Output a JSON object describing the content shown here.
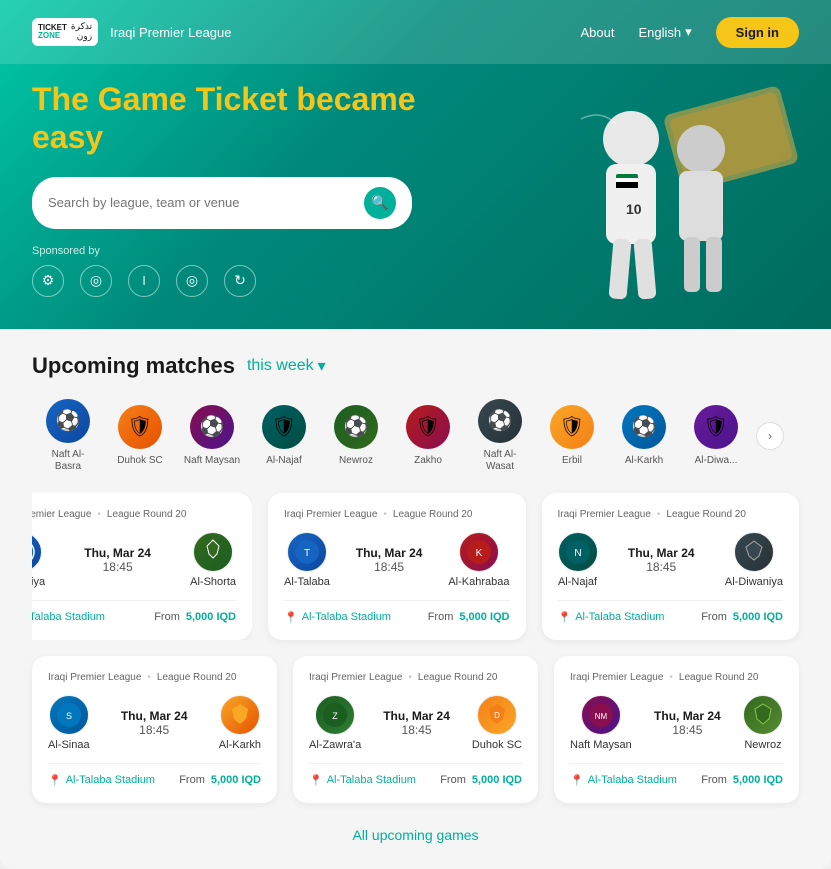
{
  "header": {
    "logo_ticket": "TICKET",
    "logo_zone": "ZONE",
    "logo_arabic": "تذكرة\nزون",
    "league_name": "Iraqi Premier League",
    "nav_about": "About",
    "nav_lang": "English",
    "nav_signin": "Sign in"
  },
  "hero": {
    "title_main": "The Game Ticket became ",
    "title_highlight": "easy",
    "search_placeholder": "Search by league, team or venue",
    "sponsored_label": "Sponsored by",
    "sponsors": [
      "⚙",
      "◎",
      "ﺍ",
      "◎",
      "↻"
    ]
  },
  "upcoming": {
    "title": "Upcoming matches",
    "filter": "this week",
    "teams": [
      {
        "name": "Naft Al-Basra",
        "emoji": "🛡"
      },
      {
        "name": "Duhok SC",
        "emoji": "🛡"
      },
      {
        "name": "Naft Maysan",
        "emoji": "🛡"
      },
      {
        "name": "Al-Najaf",
        "emoji": "🛡"
      },
      {
        "name": "Newroz",
        "emoji": "🛡"
      },
      {
        "name": "Zakho",
        "emoji": "🛡"
      },
      {
        "name": "Naft Al-Wasat",
        "emoji": "🛡"
      },
      {
        "name": "Erbil",
        "emoji": "🛡"
      },
      {
        "name": "Al-Karkh",
        "emoji": "🛡"
      },
      {
        "name": "Al-Diwa...",
        "emoji": "🛡"
      }
    ]
  },
  "partial_card": {
    "league": "Iraqi Premier League",
    "round": "League Round 20",
    "date": "Thu, Mar 24",
    "time": "18:45",
    "team1_name": "Al-Jawiya",
    "team2_name": "Al-Shorta",
    "team1_emoji": "🔵",
    "team2_emoji": "🛡",
    "venue": "Al-Talaba Stadium",
    "from_label": "From",
    "price": "5,000 IQD"
  },
  "cards": [
    {
      "league": "Iraqi Premier League",
      "round": "League Round 20",
      "date": "Thu, Mar 24",
      "time": "18:45",
      "team1_name": "Al-Talaba",
      "team2_name": "Al-Kahrabaa",
      "team1_emoji": "🔵",
      "team2_emoji": "🔴",
      "venue": "Al-Talaba Stadium",
      "from_label": "From",
      "price": "5,000 IQD"
    },
    {
      "league": "Iraqi Premier League",
      "round": "League Round 20",
      "date": "Thu, Mar 24",
      "time": "18:45",
      "team1_name": "Al-Najaf",
      "team2_name": "Al-Diwaniya",
      "team1_emoji": "🛡",
      "team2_emoji": "🛡",
      "venue": "Al-Talaba Stadium",
      "from_label": "From",
      "price": "5,000 IQD"
    }
  ],
  "bottom_cards": [
    {
      "league": "Iraqi Premier League",
      "round": "League Round 20",
      "date": "Thu, Mar 24",
      "time": "18:45",
      "team1_name": "Al-Sinaa",
      "team2_name": "Al-Karkh",
      "team1_emoji": "🛡",
      "team2_emoji": "🛡",
      "venue": "Al-Talaba Stadium",
      "from_label": "From",
      "price": "5,000 IQD"
    },
    {
      "league": "Iraqi Premier League",
      "round": "League Round 20",
      "date": "Thu, Mar 24",
      "time": "18:45",
      "team1_name": "Al-Zawra'a",
      "team2_name": "Duhok SC",
      "team1_emoji": "🟢",
      "team2_emoji": "🟡",
      "venue": "Al-Talaba Stadium",
      "from_label": "From",
      "price": "5,000 IQD"
    },
    {
      "league": "Iraqi Premier League",
      "round": "League Round 20",
      "date": "Thu, Mar 24",
      "time": "18:45",
      "team1_name": "Naft Maysan",
      "team2_name": "Newroz",
      "team1_emoji": "🛡",
      "team2_emoji": "🛡",
      "venue": "Al-Talaba Stadium",
      "from_label": "From",
      "price": "5,000 IQD"
    }
  ],
  "all_games_link": "All upcoming games",
  "colors": {
    "accent": "#00b09b",
    "yellow": "#f5c518",
    "text_dark": "#1a1a1a",
    "text_muted": "#666"
  }
}
